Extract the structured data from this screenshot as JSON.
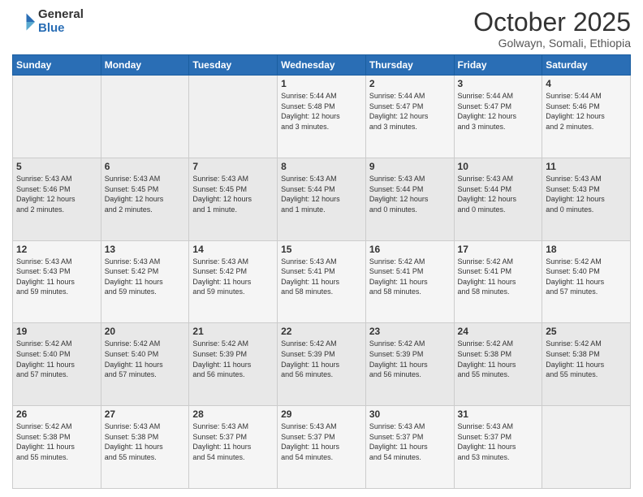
{
  "header": {
    "logo_general": "General",
    "logo_blue": "Blue",
    "month": "October 2025",
    "location": "Golwayn, Somali, Ethiopia"
  },
  "days_of_week": [
    "Sunday",
    "Monday",
    "Tuesday",
    "Wednesday",
    "Thursday",
    "Friday",
    "Saturday"
  ],
  "weeks": [
    [
      {
        "day": "",
        "info": ""
      },
      {
        "day": "",
        "info": ""
      },
      {
        "day": "",
        "info": ""
      },
      {
        "day": "1",
        "info": "Sunrise: 5:44 AM\nSunset: 5:48 PM\nDaylight: 12 hours\nand 3 minutes."
      },
      {
        "day": "2",
        "info": "Sunrise: 5:44 AM\nSunset: 5:47 PM\nDaylight: 12 hours\nand 3 minutes."
      },
      {
        "day": "3",
        "info": "Sunrise: 5:44 AM\nSunset: 5:47 PM\nDaylight: 12 hours\nand 3 minutes."
      },
      {
        "day": "4",
        "info": "Sunrise: 5:44 AM\nSunset: 5:46 PM\nDaylight: 12 hours\nand 2 minutes."
      }
    ],
    [
      {
        "day": "5",
        "info": "Sunrise: 5:43 AM\nSunset: 5:46 PM\nDaylight: 12 hours\nand 2 minutes."
      },
      {
        "day": "6",
        "info": "Sunrise: 5:43 AM\nSunset: 5:45 PM\nDaylight: 12 hours\nand 2 minutes."
      },
      {
        "day": "7",
        "info": "Sunrise: 5:43 AM\nSunset: 5:45 PM\nDaylight: 12 hours\nand 1 minute."
      },
      {
        "day": "8",
        "info": "Sunrise: 5:43 AM\nSunset: 5:44 PM\nDaylight: 12 hours\nand 1 minute."
      },
      {
        "day": "9",
        "info": "Sunrise: 5:43 AM\nSunset: 5:44 PM\nDaylight: 12 hours\nand 0 minutes."
      },
      {
        "day": "10",
        "info": "Sunrise: 5:43 AM\nSunset: 5:44 PM\nDaylight: 12 hours\nand 0 minutes."
      },
      {
        "day": "11",
        "info": "Sunrise: 5:43 AM\nSunset: 5:43 PM\nDaylight: 12 hours\nand 0 minutes."
      }
    ],
    [
      {
        "day": "12",
        "info": "Sunrise: 5:43 AM\nSunset: 5:43 PM\nDaylight: 11 hours\nand 59 minutes."
      },
      {
        "day": "13",
        "info": "Sunrise: 5:43 AM\nSunset: 5:42 PM\nDaylight: 11 hours\nand 59 minutes."
      },
      {
        "day": "14",
        "info": "Sunrise: 5:43 AM\nSunset: 5:42 PM\nDaylight: 11 hours\nand 59 minutes."
      },
      {
        "day": "15",
        "info": "Sunrise: 5:43 AM\nSunset: 5:41 PM\nDaylight: 11 hours\nand 58 minutes."
      },
      {
        "day": "16",
        "info": "Sunrise: 5:42 AM\nSunset: 5:41 PM\nDaylight: 11 hours\nand 58 minutes."
      },
      {
        "day": "17",
        "info": "Sunrise: 5:42 AM\nSunset: 5:41 PM\nDaylight: 11 hours\nand 58 minutes."
      },
      {
        "day": "18",
        "info": "Sunrise: 5:42 AM\nSunset: 5:40 PM\nDaylight: 11 hours\nand 57 minutes."
      }
    ],
    [
      {
        "day": "19",
        "info": "Sunrise: 5:42 AM\nSunset: 5:40 PM\nDaylight: 11 hours\nand 57 minutes."
      },
      {
        "day": "20",
        "info": "Sunrise: 5:42 AM\nSunset: 5:40 PM\nDaylight: 11 hours\nand 57 minutes."
      },
      {
        "day": "21",
        "info": "Sunrise: 5:42 AM\nSunset: 5:39 PM\nDaylight: 11 hours\nand 56 minutes."
      },
      {
        "day": "22",
        "info": "Sunrise: 5:42 AM\nSunset: 5:39 PM\nDaylight: 11 hours\nand 56 minutes."
      },
      {
        "day": "23",
        "info": "Sunrise: 5:42 AM\nSunset: 5:39 PM\nDaylight: 11 hours\nand 56 minutes."
      },
      {
        "day": "24",
        "info": "Sunrise: 5:42 AM\nSunset: 5:38 PM\nDaylight: 11 hours\nand 55 minutes."
      },
      {
        "day": "25",
        "info": "Sunrise: 5:42 AM\nSunset: 5:38 PM\nDaylight: 11 hours\nand 55 minutes."
      }
    ],
    [
      {
        "day": "26",
        "info": "Sunrise: 5:42 AM\nSunset: 5:38 PM\nDaylight: 11 hours\nand 55 minutes."
      },
      {
        "day": "27",
        "info": "Sunrise: 5:43 AM\nSunset: 5:38 PM\nDaylight: 11 hours\nand 55 minutes."
      },
      {
        "day": "28",
        "info": "Sunrise: 5:43 AM\nSunset: 5:37 PM\nDaylight: 11 hours\nand 54 minutes."
      },
      {
        "day": "29",
        "info": "Sunrise: 5:43 AM\nSunset: 5:37 PM\nDaylight: 11 hours\nand 54 minutes."
      },
      {
        "day": "30",
        "info": "Sunrise: 5:43 AM\nSunset: 5:37 PM\nDaylight: 11 hours\nand 54 minutes."
      },
      {
        "day": "31",
        "info": "Sunrise: 5:43 AM\nSunset: 5:37 PM\nDaylight: 11 hours\nand 53 minutes."
      },
      {
        "day": "",
        "info": ""
      }
    ]
  ]
}
